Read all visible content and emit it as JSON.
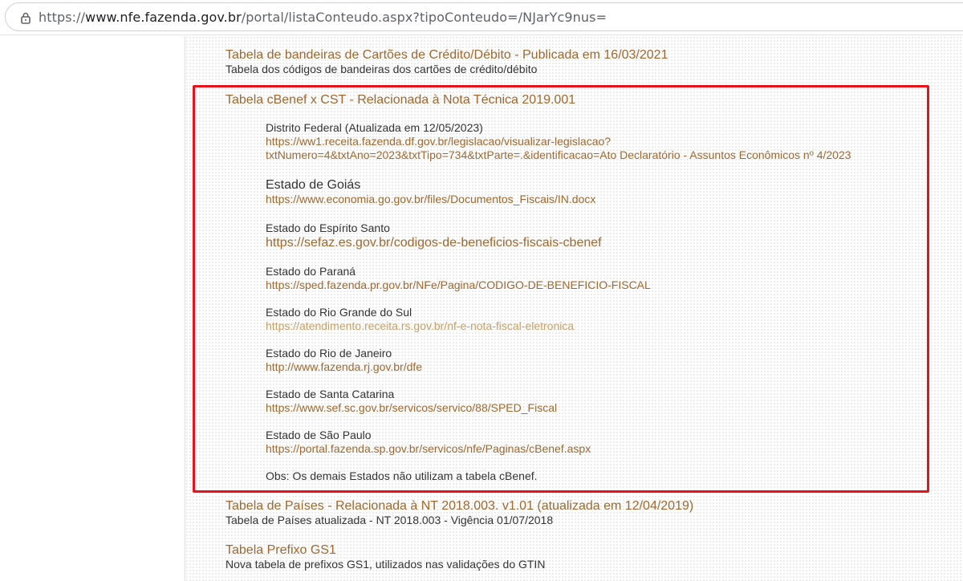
{
  "browser": {
    "url_prefix": "https://",
    "url_domain": "www.nfe.fazenda.gov.br",
    "url_path": "/portal/listaConteudo.aspx?tipoConteudo=/NJarYc9nus="
  },
  "items": [
    {
      "title": "Tabela de bandeiras de Cartões de Crédito/Débito - Publicada em 16/03/2021",
      "desc": "Tabela dos códigos de bandeiras dos cartões de crédito/débito"
    },
    {
      "title": "Tabela cBenef x CST - Relacionada à Nota Técnica 2019.001"
    },
    {
      "title": "Tabela de Países - Relacionada à NT 2018.003. v1.01 (atualizada em 12/04/2019)",
      "desc": "Tabela de Países atualizada - NT 2018.003 - Vigência 01/07/2018"
    },
    {
      "title": "Tabela Prefixo GS1",
      "desc": "Nova tabela de prefixos GS1, utilizados nas validações do GTIN"
    }
  ],
  "cbenef": {
    "states": [
      {
        "name": "Distrito Federal (Atualizada em 12/05/2023)",
        "link_line1": "https://ww1.receita.fazenda.df.gov.br/legislacao/visualizar-legislacao?",
        "link_line2": "txtNumero=4&txtAno=2023&txtTipo=734&txtParte=.&identificacao=Ato Declaratório - Assuntos Econômicos nº 4/2023"
      },
      {
        "name": "Estado de Goiás",
        "link": "https://www.economia.go.gov.br/files/Documentos_Fiscais/IN.docx"
      },
      {
        "name": "Estado do Espírito Santo",
        "link": "https://sefaz.es.gov.br/codigos-de-beneficios-fiscais-cbenef"
      },
      {
        "name": "Estado do Paraná",
        "link": "https://sped.fazenda.pr.gov.br/NFe/Pagina/CODIGO-DE-BENEFICIO-FISCAL"
      },
      {
        "name": "Estado do Rio Grande do Sul",
        "link": "https://atendimento.receita.rs.gov.br/nf-e-nota-fiscal-eletronica"
      },
      {
        "name": "Estado do Rio de Janeiro",
        "link": "http://www.fazenda.rj.gov.br/dfe"
      },
      {
        "name": "Estado de Santa Catarina",
        "link": "https://www.sef.sc.gov.br/servicos/servico/88/SPED_Fiscal"
      },
      {
        "name": "Estado de São Paulo",
        "link": "https://portal.fazenda.sp.gov.br/servicos/nfe/Paginas/cBenef.aspx"
      }
    ],
    "obs": "Obs: Os demais Estados não utilizam a tabela cBenef."
  },
  "colors": {
    "link": "#a0682e",
    "visited_link": "#c7a067",
    "text": "#333333",
    "highlight_border": "#e8131a"
  }
}
